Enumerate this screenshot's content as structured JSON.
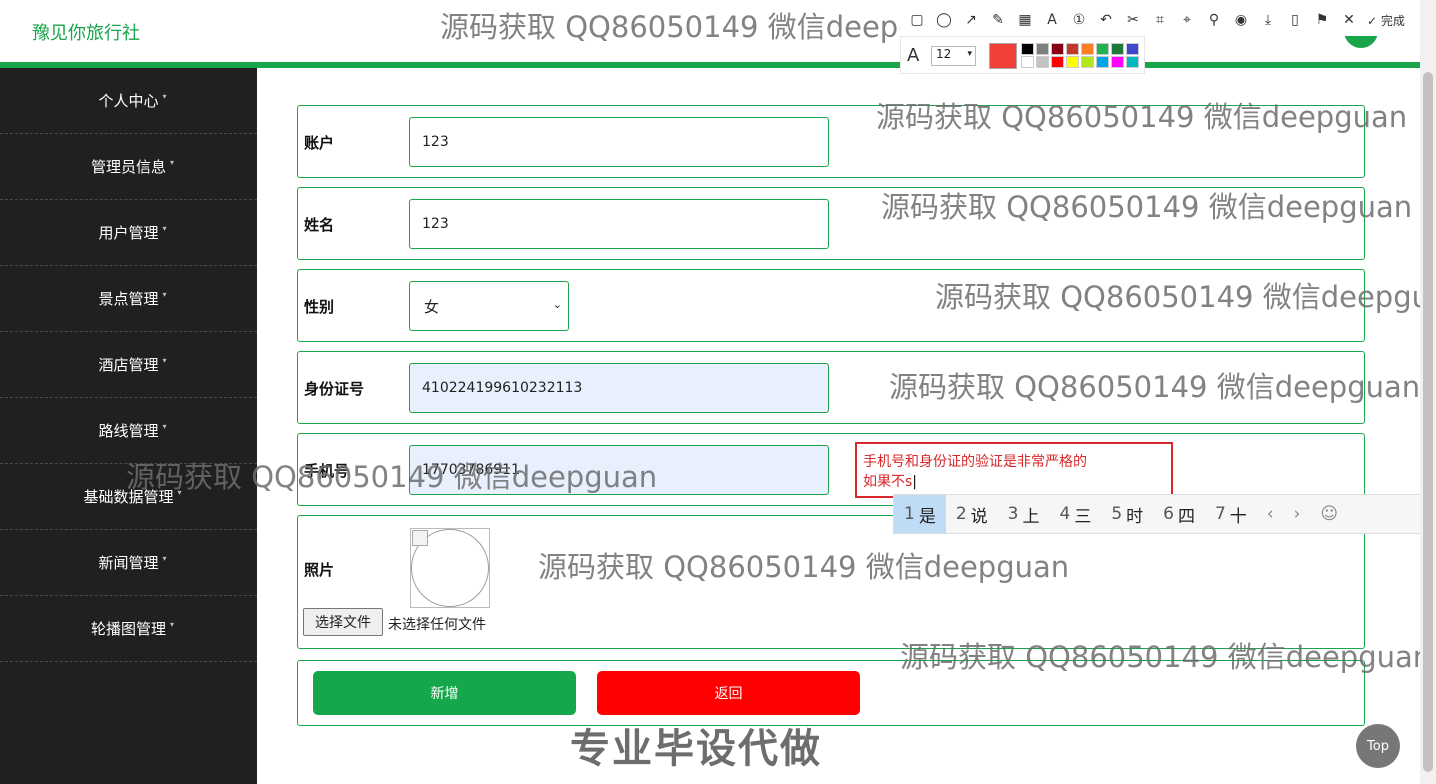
{
  "header": {
    "brand": "豫见你旅行社"
  },
  "sidebar": {
    "items": [
      {
        "label": "个人中心"
      },
      {
        "label": "管理员信息"
      },
      {
        "label": "用户管理"
      },
      {
        "label": "景点管理"
      },
      {
        "label": "酒店管理"
      },
      {
        "label": "路线管理"
      },
      {
        "label": "基础数据管理"
      },
      {
        "label": "新闻管理"
      },
      {
        "label": "轮播图管理"
      }
    ]
  },
  "form": {
    "account": {
      "label": "账户",
      "value": "123"
    },
    "name": {
      "label": "姓名",
      "value": "123"
    },
    "gender": {
      "label": "性别",
      "value": "女"
    },
    "idcard": {
      "label": "身份证号",
      "value": "410224199610232113"
    },
    "phone": {
      "label": "手机号",
      "value": "17703786911"
    },
    "photo": {
      "label": "照片",
      "file_button": "选择文件",
      "file_status": "未选择任何文件"
    },
    "buttons": {
      "add": "新增",
      "back": "返回"
    }
  },
  "annotation": {
    "line1": "手机号和身份证的验证是非常严格的",
    "line2": "如果不s"
  },
  "ime": {
    "candidates": [
      {
        "num": "1",
        "text": "是"
      },
      {
        "num": "2",
        "text": "说"
      },
      {
        "num": "3",
        "text": "上"
      },
      {
        "num": "4",
        "text": "三"
      },
      {
        "num": "5",
        "text": "时"
      },
      {
        "num": "6",
        "text": "四"
      },
      {
        "num": "7",
        "text": "十"
      }
    ],
    "prev": "‹",
    "next": "›",
    "emoji": "☺"
  },
  "toolbar": {
    "font_size": "12",
    "done": "完成"
  },
  "colors": {
    "accent": "#1aa54b",
    "annotation_red": "#f33f3a",
    "palette": [
      "#000000",
      "#7f7f7f",
      "#880015",
      "#c0392b",
      "#ff7f27",
      "#22b14c",
      "#1e7a3a",
      "#3f48cc",
      "#ffffff",
      "#c3c3c3",
      "#ff0000",
      "#ffff00",
      "#b5e61d",
      "#00a2e8",
      "#ff00ff",
      "#00b7c3"
    ]
  },
  "watermarks": {
    "text": "源码获取 QQ86050149 微信deepguan",
    "big": "专业毕设代做"
  },
  "top_button": "Top"
}
